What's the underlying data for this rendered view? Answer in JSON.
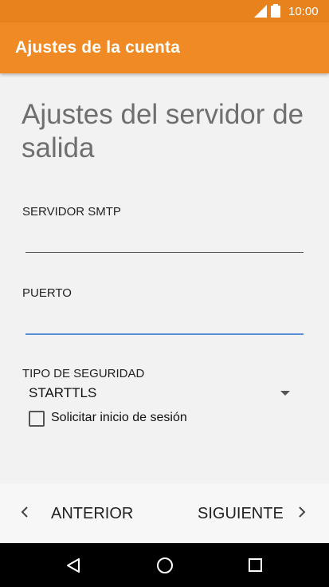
{
  "status_bar": {
    "time": "10:00",
    "signal_icon": "signal-icon",
    "battery_icon": "battery-icon"
  },
  "app_bar": {
    "title": "Ajustes de la cuenta"
  },
  "page": {
    "heading": "Ajustes del servidor de salida"
  },
  "form": {
    "smtp_server": {
      "label": "SERVIDOR SMTP",
      "value": ""
    },
    "port": {
      "label": "PUERTO",
      "value": ""
    },
    "security_type": {
      "label": "TIPO DE SEGURIDAD",
      "value": "STARTTLS"
    },
    "require_signin": {
      "label": "Solicitar inicio de sesión",
      "checked": false
    }
  },
  "footer": {
    "previous_label": "ANTERIOR",
    "next_label": "SIGUIENTE"
  },
  "colors": {
    "status_bar": "#e8821d",
    "app_bar": "#ef8a24",
    "focus_underline": "#5b8ed6"
  }
}
